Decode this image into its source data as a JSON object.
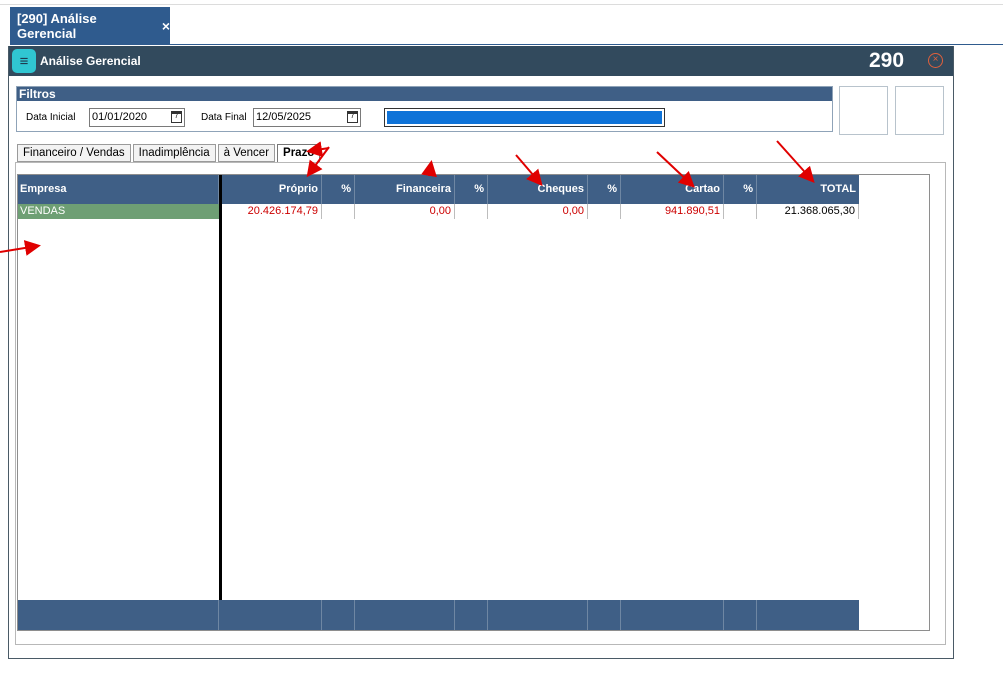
{
  "doc_tab": {
    "label": "[290] Análise Gerencial",
    "close": "×"
  },
  "window": {
    "title": "Análise Gerencial",
    "number": "290",
    "close": "×"
  },
  "filters": {
    "title": "Filtros",
    "start_label": "Data Inicial",
    "start_value": "01/01/2020",
    "end_label": "Data Final",
    "end_value": "12/05/2025",
    "calendar_glyph": "7",
    "progress": 1.0
  },
  "tabs": [
    {
      "label": "Financeiro / Vendas",
      "active": false
    },
    {
      "label": "Inadimplência",
      "active": false
    },
    {
      "label": "à Vencer",
      "active": false
    },
    {
      "label": "Prazo",
      "active": true
    }
  ],
  "table": {
    "headers": [
      "Empresa",
      "Próprio",
      "%",
      "Financeira",
      "%",
      "Cheques",
      "%",
      "Cartao",
      "%",
      "TOTAL"
    ],
    "rows": [
      {
        "empresa": "VENDAS",
        "proprio": "20.426.174,79",
        "p1": "",
        "financeira": "0,00",
        "p2": "",
        "cheques": "0,00",
        "p3": "",
        "cartao": "941.890,51",
        "p4": "",
        "total": "21.368.065,30"
      }
    ]
  },
  "colors": {
    "header": "#3f5f86",
    "titlebar": "#324a5d",
    "accent": "#2f5b8e",
    "row_highlight": "#6e9f74",
    "value_red": "#cc0000",
    "annotation_red": "#e00000"
  }
}
